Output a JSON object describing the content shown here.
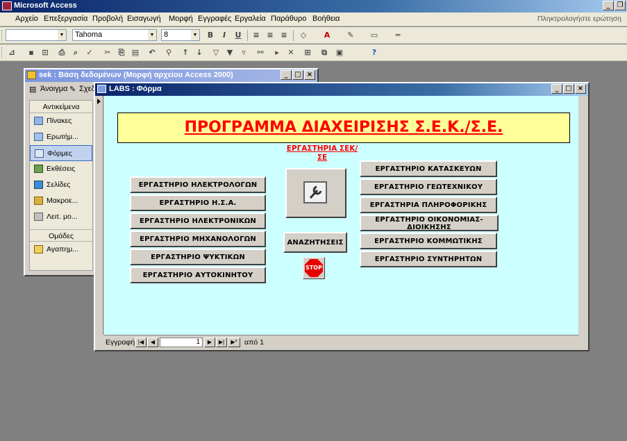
{
  "app": {
    "title": "Microsoft Access"
  },
  "menu": {
    "items": [
      "Αρχείο",
      "Επεξεργασία",
      "Προβολή",
      "Εισαγωγή",
      "Μορφή",
      "Εγγραφές",
      "Εργαλεία",
      "Παράθυρο",
      "Βοήθεια"
    ],
    "help_placeholder": "Πληκτρολογήστε ερώτηση"
  },
  "format_toolbar": {
    "object": "",
    "font": "Tahoma",
    "size": "8"
  },
  "db_window": {
    "title": "sek : Βάση δεδομένων (Μορφή αρχείου Access 2000)",
    "open_label": "Άνοιγμα",
    "design_label": "Σχεδ",
    "objects_header": "Αντικείμενα",
    "objects": [
      "Πίνακες",
      "Ερωτήμ...",
      "Φόρμες",
      "Εκθέσεις",
      "Σελίδες",
      "Μακροε...",
      "Λειτ. μο..."
    ],
    "groups_header": "Ομάδες",
    "groups": [
      "Αγαπημ..."
    ]
  },
  "form": {
    "title": "LABS : Φόρμα",
    "banner": "ΠΡΟΓΡΑΜΜΑ ΔΙΑΧΕΙΡΙΣΗΣ Σ.Ε.Κ./Σ.Ε.",
    "lab_heading": "ΕΡΓΑΣΤΗΡΙΑ ΣΕΚ/ΣΕ",
    "left_buttons": [
      "ΕΡΓΑΣΤΗΡΙΟ ΗΛΕΚΤΡΟΛΟΓΩΝ",
      "ΕΡΓΑΣΤΗΡΙΟ Η.Σ.Α.",
      "ΕΡΓΑΣΤΗΡΙΟ ΗΛΕΚΤΡΟΝΙΚΩΝ",
      "ΕΡΓΑΣΤΗΡΙΟ ΜΗΧΑΝΟΛΟΓΩΝ",
      "ΕΡΓΑΣΤΗΡΙΟ ΨΥΚΤΙΚΩΝ",
      "ΕΡΓΑΣΤΗΡΙΟ ΑΥΤΟΚΙΝΗΤΟΥ"
    ],
    "right_buttons": [
      "ΕΡΓΑΣΤΗΡΙΟ ΚΑΤΑΣΚΕΥΩΝ",
      "ΕΡΓΑΣΤΗΡΙΟ ΓΕΩΤΕΧΝΙΚΟΥ",
      "ΕΡΓΑΣΤΗΡΙΑ ΠΛΗΡΟΦΟΡΙΚΗΣ",
      "ΕΡΓΑΣΤΗΡΙΟ ΟΙΚΟΝΟΜΙΑΣ-ΔΙΟΙΚΗΣΗΣ",
      "ΕΡΓΑΣΤΗΡΙΟ ΚΟΜΜΩΤΙΚΗΣ",
      "ΕΡΓΑΣΤΗΡΙΟ ΣΥΝΤΗΡΗΤΩΝ"
    ],
    "search_button": "ΑΝΑΖΗΤΗΣΕΙΣ",
    "stop_label": "STOP"
  },
  "record_nav": {
    "label": "Εγγραφή:",
    "current": "1",
    "of_label": "από 1"
  },
  "colors": {
    "banner_bg": "#ffff99",
    "banner_text": "#ff0000",
    "form_bg": "#ccffff"
  }
}
